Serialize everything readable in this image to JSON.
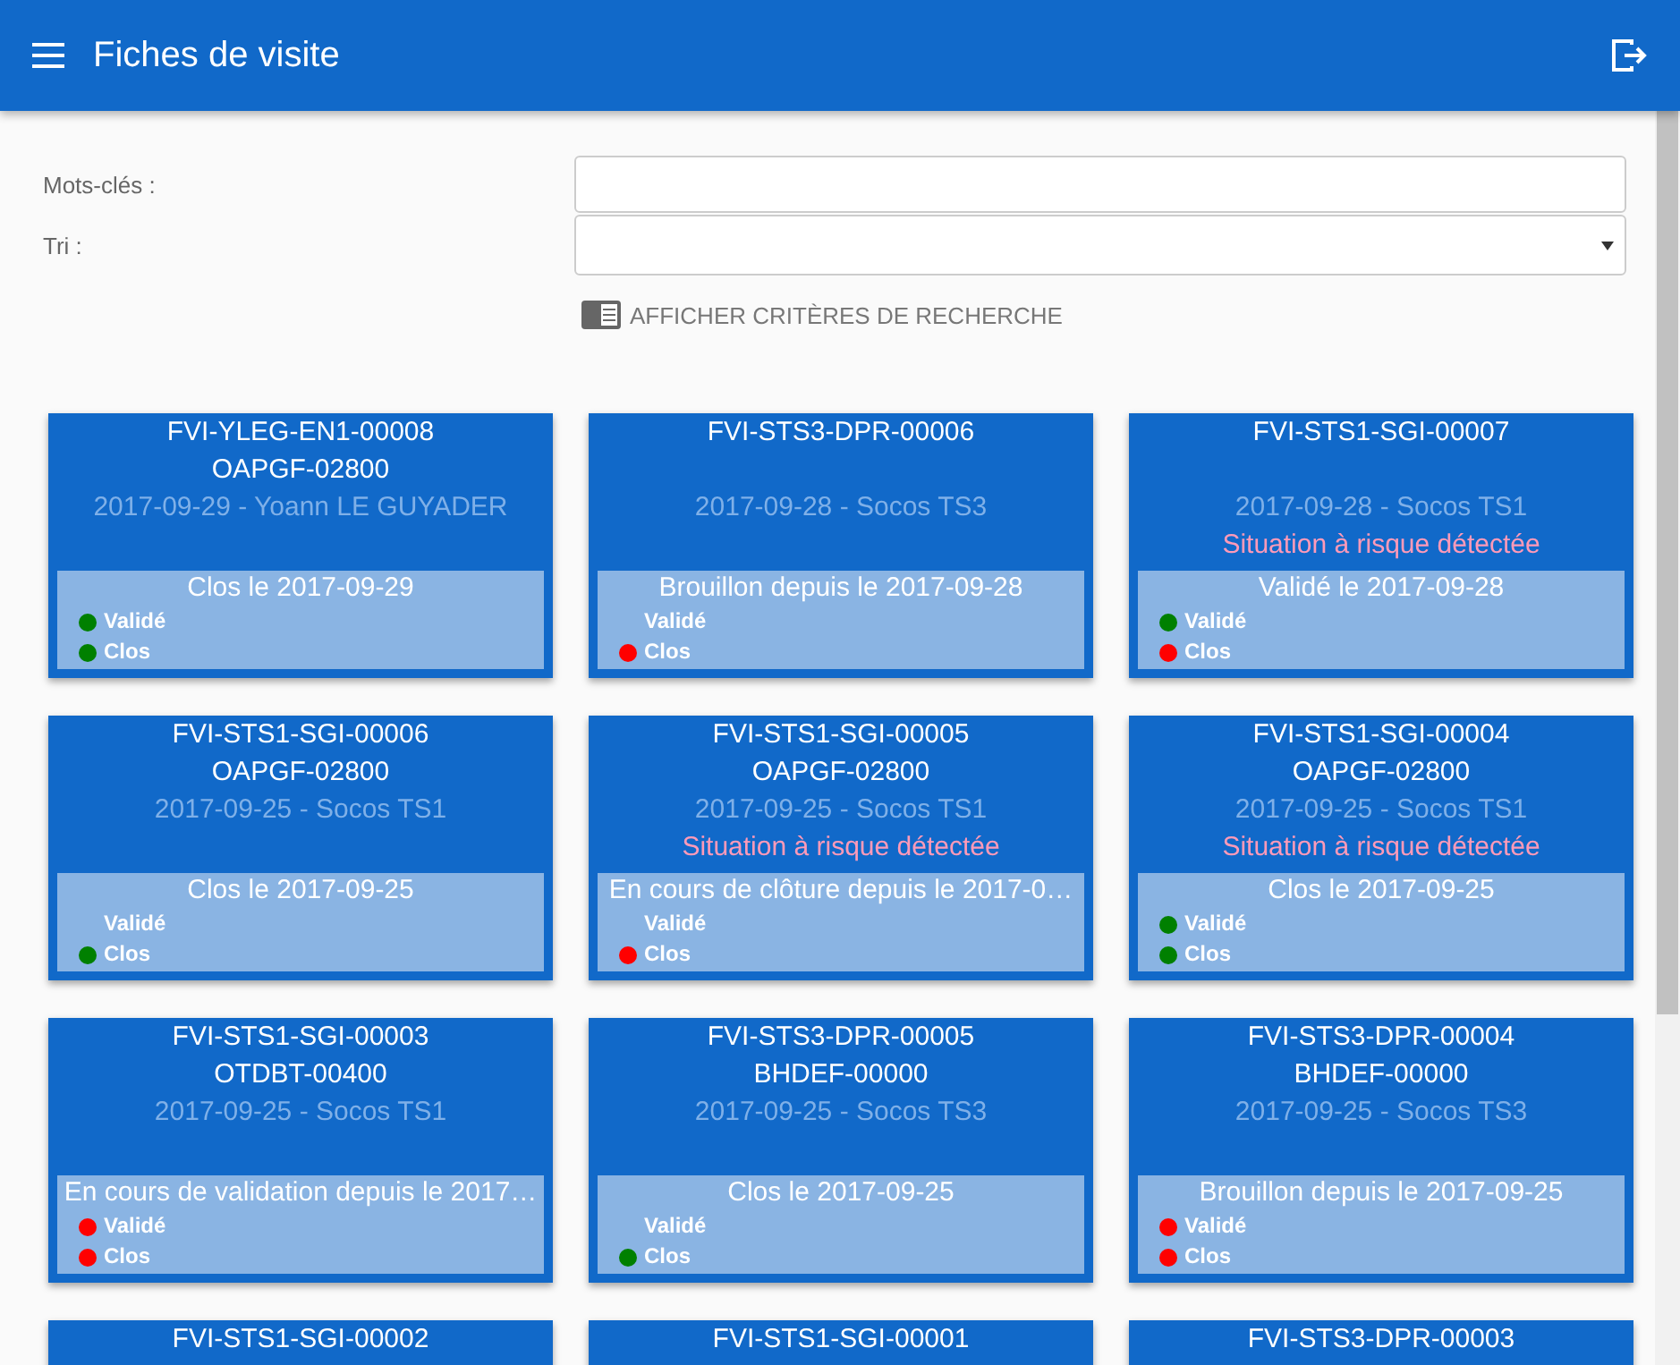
{
  "app_bar": {
    "title": "Fiches de visite"
  },
  "filters": {
    "keywords_label": "Mots-clés :",
    "sort_label": "Tri :",
    "toggle_criteria": "AFFICHER CRITÈRES DE RECHERCHE"
  },
  "cards": [
    {
      "reference": "FVI-YLEG-EN1-00008",
      "code": "OAPGF-02800",
      "date_author": "2017-09-29 - Yoann LE GUYADER",
      "status": "Clos le 2017-09-29",
      "checks": [
        {
          "label": "Validé",
          "color": "#008000"
        },
        {
          "label": "Clos",
          "color": "#008000"
        }
      ]
    },
    {
      "reference": "FVI-STS3-DPR-00006",
      "date_author": "2017-09-28 - Socos TS3",
      "status": "Brouillon depuis le 2017-09-28",
      "checks": [
        {
          "label": "Validé"
        },
        {
          "label": "Clos",
          "color": "#ff0000"
        }
      ]
    },
    {
      "reference": "FVI-STS1-SGI-00007",
      "date_author": "2017-09-28 - Socos TS1",
      "risk": "Situation à risque détectée",
      "status": "Validé le 2017-09-28",
      "checks": [
        {
          "label": "Validé",
          "color": "#008000"
        },
        {
          "label": "Clos",
          "color": "#ff0000"
        }
      ]
    },
    {
      "reference": "FVI-STS1-SGI-00006",
      "code": "OAPGF-02800",
      "date_author": "2017-09-25 - Socos TS1",
      "status": "Clos le 2017-09-25",
      "checks": [
        {
          "label": "Validé"
        },
        {
          "label": "Clos",
          "color": "#008000"
        }
      ]
    },
    {
      "reference": "FVI-STS1-SGI-00005",
      "code": "OAPGF-02800",
      "date_author": "2017-09-25 - Socos TS1",
      "risk": "Situation à risque détectée",
      "status": "En cours de clôture depuis le 2017-0…",
      "checks": [
        {
          "label": "Validé"
        },
        {
          "label": "Clos",
          "color": "#ff0000"
        }
      ]
    },
    {
      "reference": "FVI-STS1-SGI-00004",
      "code": "OAPGF-02800",
      "date_author": "2017-09-25 - Socos TS1",
      "risk": "Situation à risque détectée",
      "status": "Clos le 2017-09-25",
      "checks": [
        {
          "label": "Validé",
          "color": "#008000"
        },
        {
          "label": "Clos",
          "color": "#008000"
        }
      ]
    },
    {
      "reference": "FVI-STS1-SGI-00003",
      "code": "OTDBT-00400",
      "date_author": "2017-09-25 - Socos TS1",
      "status": "En cours de validation depuis le 2017…",
      "checks": [
        {
          "label": "Validé",
          "color": "#ff0000"
        },
        {
          "label": "Clos",
          "color": "#ff0000"
        }
      ]
    },
    {
      "reference": "FVI-STS3-DPR-00005",
      "code": "BHDEF-00000",
      "date_author": "2017-09-25 - Socos TS3",
      "status": "Clos le 2017-09-25",
      "checks": [
        {
          "label": "Validé"
        },
        {
          "label": "Clos",
          "color": "#008000"
        }
      ]
    },
    {
      "reference": "FVI-STS3-DPR-00004",
      "code": "BHDEF-00000",
      "date_author": "2017-09-25 - Socos TS3",
      "status": "Brouillon depuis le 2017-09-25",
      "checks": [
        {
          "label": "Validé",
          "color": "#ff0000"
        },
        {
          "label": "Clos",
          "color": "#ff0000"
        }
      ]
    },
    {
      "reference": "FVI-STS1-SGI-00002"
    },
    {
      "reference": "FVI-STS1-SGI-00001"
    },
    {
      "reference": "FVI-STS3-DPR-00003"
    }
  ]
}
